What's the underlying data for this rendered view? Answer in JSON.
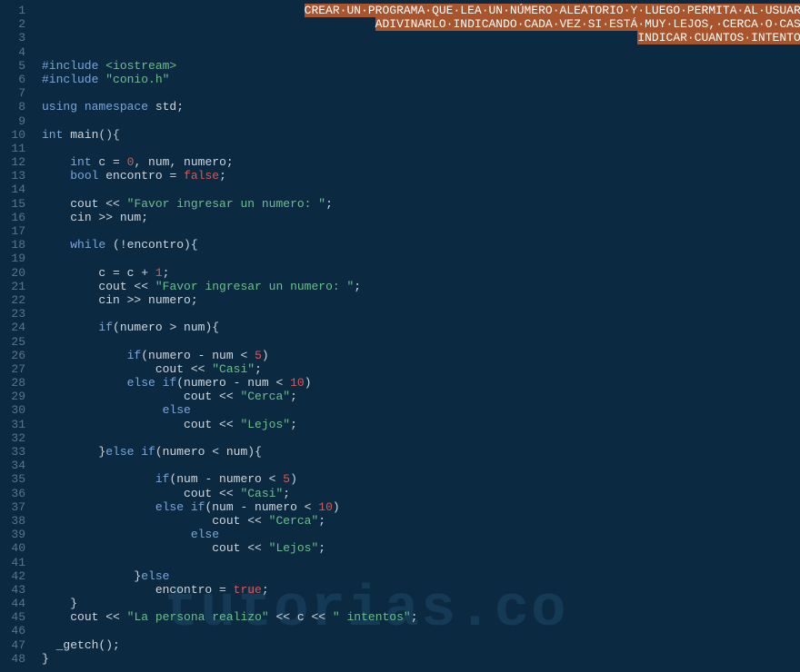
{
  "watermark": "tutorias.co",
  "gutter": {
    "start": 1,
    "end": 48
  },
  "comment": {
    "l1": "CREAR·UN·PROGRAMA·QUE·LEA·UN·NÚMERO·ALEATORIO·Y·LUEGO·PERMITA·AL·USUARIO",
    "l2": "ADIVINARLO·INDICANDO·CADA·VEZ·SI·ESTÁ·MUY·LEJOS,·CERCA·O·CASI·E",
    "l3": "INDICAR·CUANTOS·INTENTOS·REALIZO"
  },
  "code": {
    "include1_a": "#include ",
    "include1_b": "<iostream>",
    "include2_a": "#include ",
    "include2_b": "\"conio.h\"",
    "using_kw": "using",
    "namespace_kw": " namespace",
    "std": " std;",
    "intkw": "int",
    "main": " main",
    "mainparen": "(){",
    "l12_int": "int",
    "l12_rest_a": " c = ",
    "l12_zero": "0",
    "l12_rest_b": ", num, numero;",
    "l13_bool": "bool",
    "l13_mid": " encontro = ",
    "l13_false": "false",
    "l13_semi": ";",
    "l15_a": "cout << ",
    "l15_str": "\"Favor ingresar un numero: \"",
    "l15_b": ";",
    "l16": "cin >> num;",
    "l18_while": "while",
    "l18_rest": " (!encontro){",
    "l20_a": "c = c + ",
    "l20_one": "1",
    "l20_b": ";",
    "l21_a": "cout << ",
    "l21_str": "\"Favor ingresar un numero: \"",
    "l21_b": ";",
    "l22": "cin >> numero;",
    "l24_if": "if",
    "l24_rest": "(numero > num){",
    "l26_if": "if",
    "l26_a": "(numero - num < ",
    "l26_five": "5",
    "l26_b": ")",
    "l27_a": "cout << ",
    "l27_str": "\"Casi\"",
    "l27_b": ";",
    "l28_else": "else",
    "l28_if": " if",
    "l28_a": "(numero - num < ",
    "l28_ten": "10",
    "l28_b": ")",
    "l29_a": "cout << ",
    "l29_str": "\"Cerca\"",
    "l29_b": ";",
    "l30_else": "else",
    "l31_a": "cout << ",
    "l31_str": "\"Lejos\"",
    "l31_b": ";",
    "l33_a": "}",
    "l33_else": "else",
    "l33_if": " if",
    "l33_b": "(numero < num){",
    "l35_if": "if",
    "l35_a": "(num - numero < ",
    "l35_five": "5",
    "l35_b": ")",
    "l36_a": "cout << ",
    "l36_str": "\"Casi\"",
    "l36_b": ";",
    "l37_else": "else",
    "l37_if": " if",
    "l37_a": "(num - numero < ",
    "l37_ten": "10",
    "l37_b": ")",
    "l38_a": "cout << ",
    "l38_str": "\"Cerca\"",
    "l38_b": ";",
    "l39_else": "else",
    "l40_a": "cout << ",
    "l40_str": "\"Lejos\"",
    "l40_b": ";",
    "l42_a": "}",
    "l42_else": "else",
    "l43_a": "encontro = ",
    "l43_true": "true",
    "l43_b": ";",
    "l44": "}",
    "l45_a": "cout << ",
    "l45_str1": "\"La persona realizo\"",
    "l45_mid": " << c << ",
    "l45_str2": "\" intentos\"",
    "l45_b": ";",
    "l47": "_getch();",
    "l48": "}"
  }
}
